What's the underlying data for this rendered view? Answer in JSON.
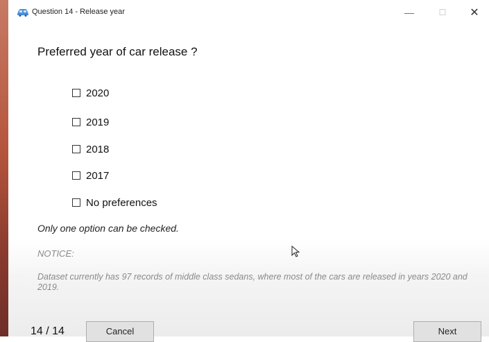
{
  "window": {
    "title": "Question 14 - Release year",
    "min_glyph": "—",
    "max_glyph": "☐",
    "close_glyph": "✕"
  },
  "question": {
    "text": "Preferred year of car release ?",
    "options": [
      {
        "label": "2020",
        "checked": false
      },
      {
        "label": "2019",
        "checked": false
      },
      {
        "label": "2018",
        "checked": false
      },
      {
        "label": "2017",
        "checked": false
      },
      {
        "label": "No preferences",
        "checked": false
      }
    ],
    "hint": "Only one option can be checked."
  },
  "notice": {
    "label": "NOTICE:",
    "body": "Dataset currently has 97 records of middle class sedans, where most of the cars are released in years 2020 and 2019."
  },
  "footer": {
    "progress": "14 / 14",
    "cancel_label": "Cancel",
    "next_label": "Next"
  },
  "colors": {
    "accent_icon": "#4a90d9",
    "notice_text": "#8a8a8a",
    "button_bg": "#e1e1e1"
  }
}
